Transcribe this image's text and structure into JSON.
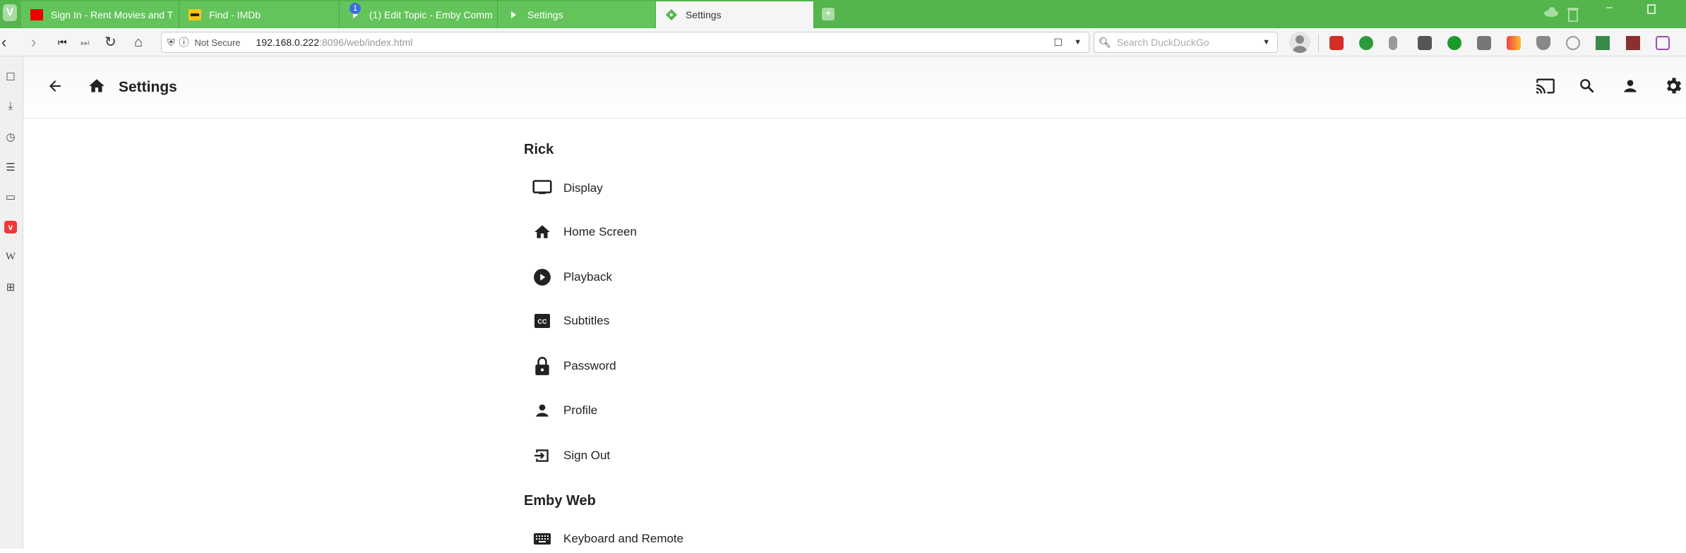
{
  "browser": {
    "tabs": [
      {
        "label": "Sign In - Rent Movies and T",
        "icon": "red-square-icon"
      },
      {
        "label": "Find - IMDb",
        "icon": "imdb-icon"
      },
      {
        "label": "(1) Edit Topic - Emby Comm",
        "icon": "emby-icon",
        "badge": "1"
      },
      {
        "label": "Settings",
        "icon": "emby-icon"
      },
      {
        "label": "Settings",
        "icon": "emby-icon",
        "active": true
      }
    ],
    "url_prefix": "Not Secure",
    "url_host": "192.168.0.222",
    "url_rest": ":8096/web/index.html",
    "search_placeholder": "Search DuckDuckGo"
  },
  "header": {
    "title": "Settings"
  },
  "sections": [
    {
      "title": "Rick",
      "items": [
        {
          "label": "Display",
          "icon": "tv-icon"
        },
        {
          "label": "Home Screen",
          "icon": "home-icon"
        },
        {
          "label": "Playback",
          "icon": "play-circle-icon"
        },
        {
          "label": "Subtitles",
          "icon": "closed-caption-icon"
        },
        {
          "label": "Password",
          "icon": "lock-icon"
        },
        {
          "label": "Profile",
          "icon": "person-icon"
        },
        {
          "label": "Sign Out",
          "icon": "exit-icon"
        }
      ]
    },
    {
      "title": "Emby Web",
      "items": [
        {
          "label": "Keyboard and Remote",
          "icon": "keyboard-icon"
        }
      ]
    }
  ],
  "colors": {
    "browser_accent": "#53b54b"
  }
}
